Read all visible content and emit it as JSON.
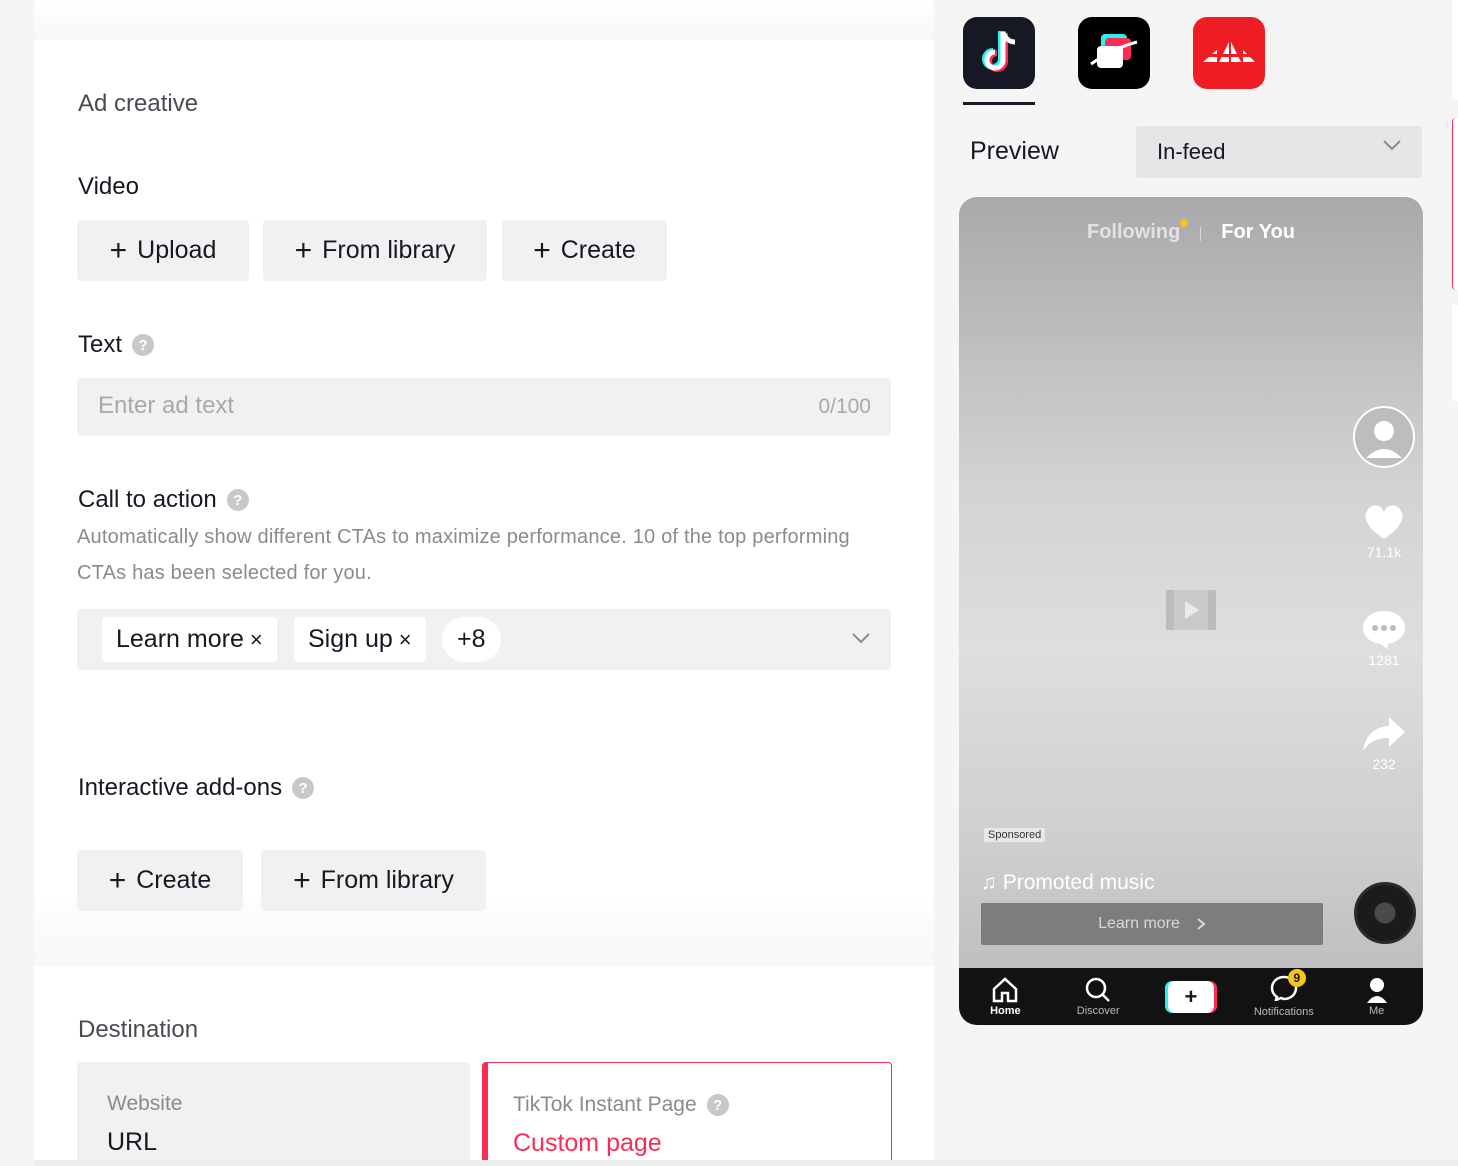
{
  "ad_creative": {
    "section_title": "Ad creative",
    "video": {
      "label": "Video",
      "upload": "Upload",
      "from_library": "From library",
      "create": "Create"
    },
    "text": {
      "label": "Text",
      "placeholder": "Enter ad text",
      "counter": "0/100"
    },
    "cta": {
      "label": "Call to action",
      "description": "Automatically show different CTAs to maximize performance. 10 of the top performing CTAs has been selected for you.",
      "chips": [
        "Learn more",
        "Sign up"
      ],
      "more_count": "+8"
    }
  },
  "addons": {
    "label": "Interactive add-ons",
    "create": "Create",
    "from_library": "From library"
  },
  "destination": {
    "title": "Destination",
    "website": {
      "label": "Website",
      "value": "URL"
    },
    "instant_page": {
      "label": "TikTok Instant Page",
      "value": "Custom page"
    }
  },
  "preview": {
    "apps": [
      "tiktok-icon",
      "pangle-icon",
      "other-app-icon"
    ],
    "label": "Preview",
    "placement": "In-feed",
    "phone": {
      "following": "Following",
      "for_you": "For You",
      "likes": "71.1k",
      "comments": "1281",
      "shares": "232",
      "sponsored": "Sponsored",
      "music": "Promoted music",
      "learn_more": "Learn more",
      "nav": {
        "home": "Home",
        "discover": "Discover",
        "notifications": "Notifications",
        "notif_badge": "9",
        "me": "Me"
      }
    }
  },
  "colors": {
    "accent": "#fe2c55",
    "cyan": "#25f4ee",
    "button_bg": "#f1f1f2"
  }
}
